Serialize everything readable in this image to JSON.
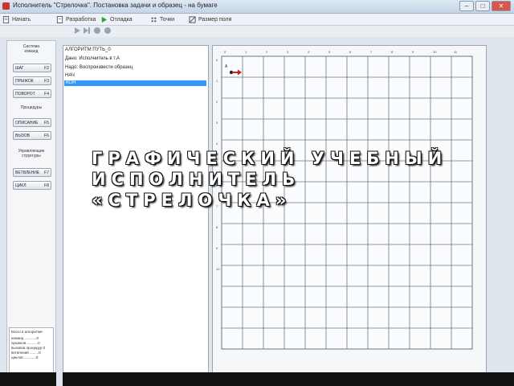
{
  "window": {
    "title": "Исполнитель \"Стрелочка\". Постановка задачи и образец - на бумаге",
    "buttons": {
      "minimize": "–",
      "maximize": "□",
      "close": "✕"
    }
  },
  "toolbar": {
    "start": "Начать",
    "develop": "Разработка",
    "debug": "Отладка",
    "points": "Точки",
    "field_size": "Размер поля"
  },
  "left_panel": {
    "system_title": "Система\nкоманд",
    "commands": [
      {
        "label": "ШАГ",
        "key": "F2"
      },
      {
        "label": "ПРЫЖОК",
        "key": "F3"
      },
      {
        "label": "ПОВОРОТ",
        "key": "F4"
      }
    ],
    "procedures_title": "Процедуры",
    "procedures": [
      {
        "label": "ОПИСАНИЕ",
        "key": "F5"
      },
      {
        "label": "ВЫЗОВ",
        "key": "F6"
      }
    ],
    "control_title": "Управляющие\nструктуры",
    "control": [
      {
        "label": "ВЕТВЛЕНИЕ",
        "key": "F7"
      },
      {
        "label": "ЦИКЛ",
        "key": "F8"
      }
    ],
    "stats": {
      "header": "Всего в алгоритме:",
      "rows": [
        "команд ............0",
        "прыжков ...........0",
        "вызовов процедур 0",
        "ветвлений .........0",
        "циклов ............0"
      ]
    }
  },
  "algorithm": {
    "lines": [
      "АЛГОРИТМ ПУТЬ_0",
      "   Дано: Исполнитель в т.А",
      "   Надо: Воспроизвести образец",
      "НАЧ"
    ],
    "selected": "КОН"
  },
  "field": {
    "col_labels": [
      "0",
      "1",
      "2",
      "3",
      "4",
      "5",
      "6",
      "7",
      "8",
      "9",
      "10",
      "11"
    ],
    "row_labels": [
      "0",
      "1",
      "2",
      "3",
      "4",
      "5",
      "6",
      "7",
      "8",
      "9",
      "10"
    ],
    "point_label": "А",
    "arrow_color": "#cc1f1f",
    "grid_color": "#6d7682"
  },
  "overlay": {
    "line1": "ГРАФИЧЕСКИЙ УЧЕБНЫЙ",
    "line2": "ИСПОЛНИТЕЛЬ",
    "line3": "«СТРЕЛОЧКА»"
  }
}
